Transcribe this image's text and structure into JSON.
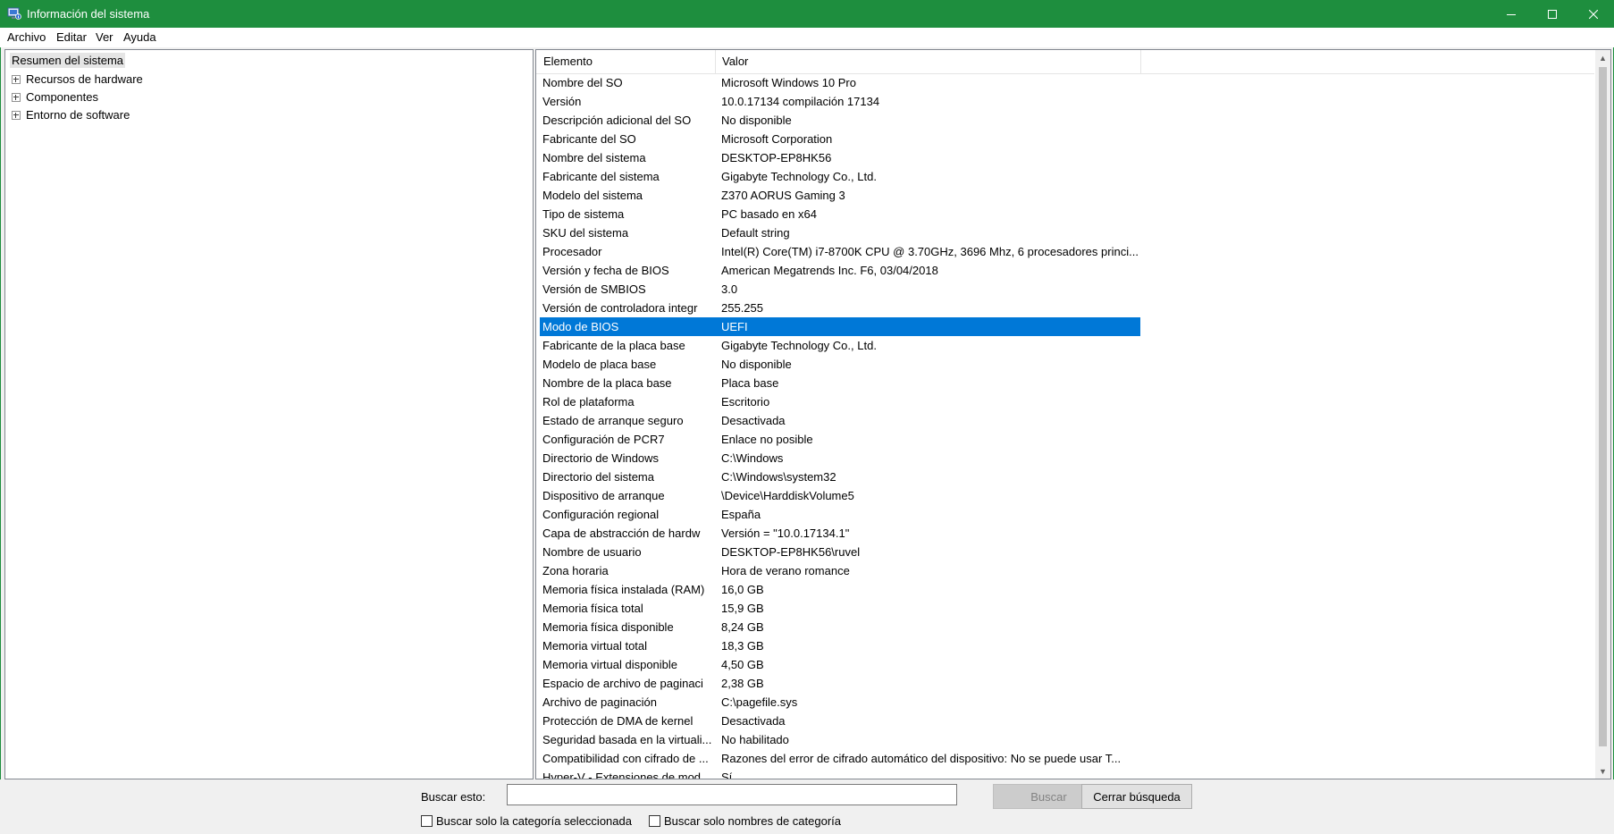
{
  "window": {
    "title": "Información del sistema",
    "accent": "#1e8e3e",
    "icons": {
      "app": "system-info-icon",
      "minimize": "minimize-icon",
      "maximize": "maximize-icon",
      "close": "close-icon"
    }
  },
  "menu": {
    "items": [
      "Archivo",
      "Editar",
      "Ver",
      "Ayuda"
    ]
  },
  "tree": {
    "root": "Resumen del sistema",
    "children": [
      "Recursos de hardware",
      "Componentes",
      "Entorno de software"
    ]
  },
  "table": {
    "headers": [
      "Elemento",
      "Valor"
    ],
    "selected_index": 13,
    "selected_color": "#0078d7",
    "rows": [
      [
        "Nombre del SO",
        "Microsoft Windows 10 Pro"
      ],
      [
        "Versión",
        "10.0.17134 compilación 17134"
      ],
      [
        "Descripción adicional del SO",
        "No disponible"
      ],
      [
        "Fabricante del SO",
        "Microsoft Corporation"
      ],
      [
        "Nombre del sistema",
        "DESKTOP-EP8HK56"
      ],
      [
        "Fabricante del sistema",
        "Gigabyte Technology Co., Ltd."
      ],
      [
        "Modelo del sistema",
        "Z370 AORUS Gaming 3"
      ],
      [
        "Tipo de sistema",
        "PC basado en x64"
      ],
      [
        "SKU del sistema",
        "Default string"
      ],
      [
        "Procesador",
        "Intel(R) Core(TM) i7-8700K CPU @ 3.70GHz, 3696 Mhz, 6 procesadores princi..."
      ],
      [
        "Versión y fecha de BIOS",
        "American Megatrends Inc. F6, 03/04/2018"
      ],
      [
        "Versión de SMBIOS",
        "3.0"
      ],
      [
        "Versión de controladora integr",
        "255.255"
      ],
      [
        "Modo de BIOS",
        "UEFI"
      ],
      [
        "Fabricante de la placa base",
        "Gigabyte Technology Co., Ltd."
      ],
      [
        "Modelo de placa base",
        "No disponible"
      ],
      [
        "Nombre de la placa base",
        "Placa base"
      ],
      [
        "Rol de plataforma",
        "Escritorio"
      ],
      [
        "Estado de arranque seguro",
        "Desactivada"
      ],
      [
        "Configuración de PCR7",
        "Enlace no posible"
      ],
      [
        "Directorio de Windows",
        "C:\\Windows"
      ],
      [
        "Directorio del sistema",
        "C:\\Windows\\system32"
      ],
      [
        "Dispositivo de arranque",
        "\\Device\\HarddiskVolume5"
      ],
      [
        "Configuración regional",
        "España"
      ],
      [
        "Capa de abstracción de hardw",
        "Versión = \"10.0.17134.1\""
      ],
      [
        "Nombre de usuario",
        "DESKTOP-EP8HK56\\ruvel"
      ],
      [
        "Zona horaria",
        "Hora de verano romance"
      ],
      [
        "Memoria física instalada (RAM)",
        "16,0 GB"
      ],
      [
        "Memoria física total",
        "15,9 GB"
      ],
      [
        "Memoria física disponible",
        "8,24 GB"
      ],
      [
        "Memoria virtual total",
        "18,3 GB"
      ],
      [
        "Memoria virtual disponible",
        "4,50 GB"
      ],
      [
        "Espacio de archivo de paginaci",
        "2,38 GB"
      ],
      [
        "Archivo de paginación",
        "C:\\pagefile.sys"
      ],
      [
        "Protección de DMA de kernel",
        "Desactivada"
      ],
      [
        "Seguridad basada en la virtuali...",
        "No habilitado"
      ],
      [
        "Compatibilidad con cifrado de ...",
        "Razones del error de cifrado automático del dispositivo: No se puede usar T..."
      ],
      [
        "Hyper-V - Extensiones de mod...",
        "Sí"
      ]
    ]
  },
  "search": {
    "label": "Buscar esto:",
    "value": "",
    "search_button": "Buscar",
    "close_button": "Cerrar búsqueda",
    "option_category": "Buscar solo la categoría seleccionada",
    "option_names": "Buscar solo nombres de categoría"
  }
}
